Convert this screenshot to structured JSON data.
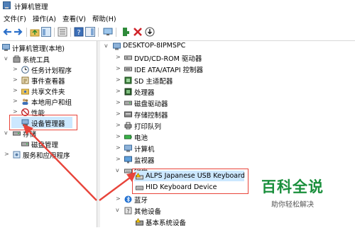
{
  "window": {
    "title": "计算机管理"
  },
  "menu": [
    "文件(F)",
    "操作(A)",
    "查看(V)",
    "帮助(H)"
  ],
  "left_tree": {
    "root": "计算机管理(本地)",
    "system_tools": "系统工具",
    "task_scheduler": "任务计划程序",
    "event_viewer": "事件查看器",
    "shared_folders": "共享文件夹",
    "local_users": "本地用户和组",
    "performance": "性能",
    "device_manager": "设备管理器",
    "storage": "存储",
    "disk_management": "磁盘管理",
    "services_apps": "服务和应用程序"
  },
  "right_tree": {
    "computer_name": "DESKTOP-8IPMSPC",
    "dvd": "DVD/CD-ROM 驱动器",
    "ide": "IDE ATA/ATAPI 控制器",
    "sd": "SD 主适配器",
    "processor": "处理器",
    "disk_drives": "磁盘驱动器",
    "storage_ctrl": "存储控制器",
    "print_queue": "打印队列",
    "battery": "电池",
    "computer": "计算机",
    "monitor": "监视器",
    "keyboard": "键盘",
    "kb_alps": "ALPS Japanese USB Keyboard",
    "kb_hid": "HID Keyboard Device",
    "bluetooth": "蓝牙",
    "other_devices": "其他设备",
    "base_system": "基本系统设备"
  },
  "watermark": {
    "main": "百科全说",
    "sub": "助你轻松解决"
  },
  "colors": {
    "highlight": "#e8443a",
    "selection": "#cce8ff",
    "watermark": "#1a8f3c"
  }
}
